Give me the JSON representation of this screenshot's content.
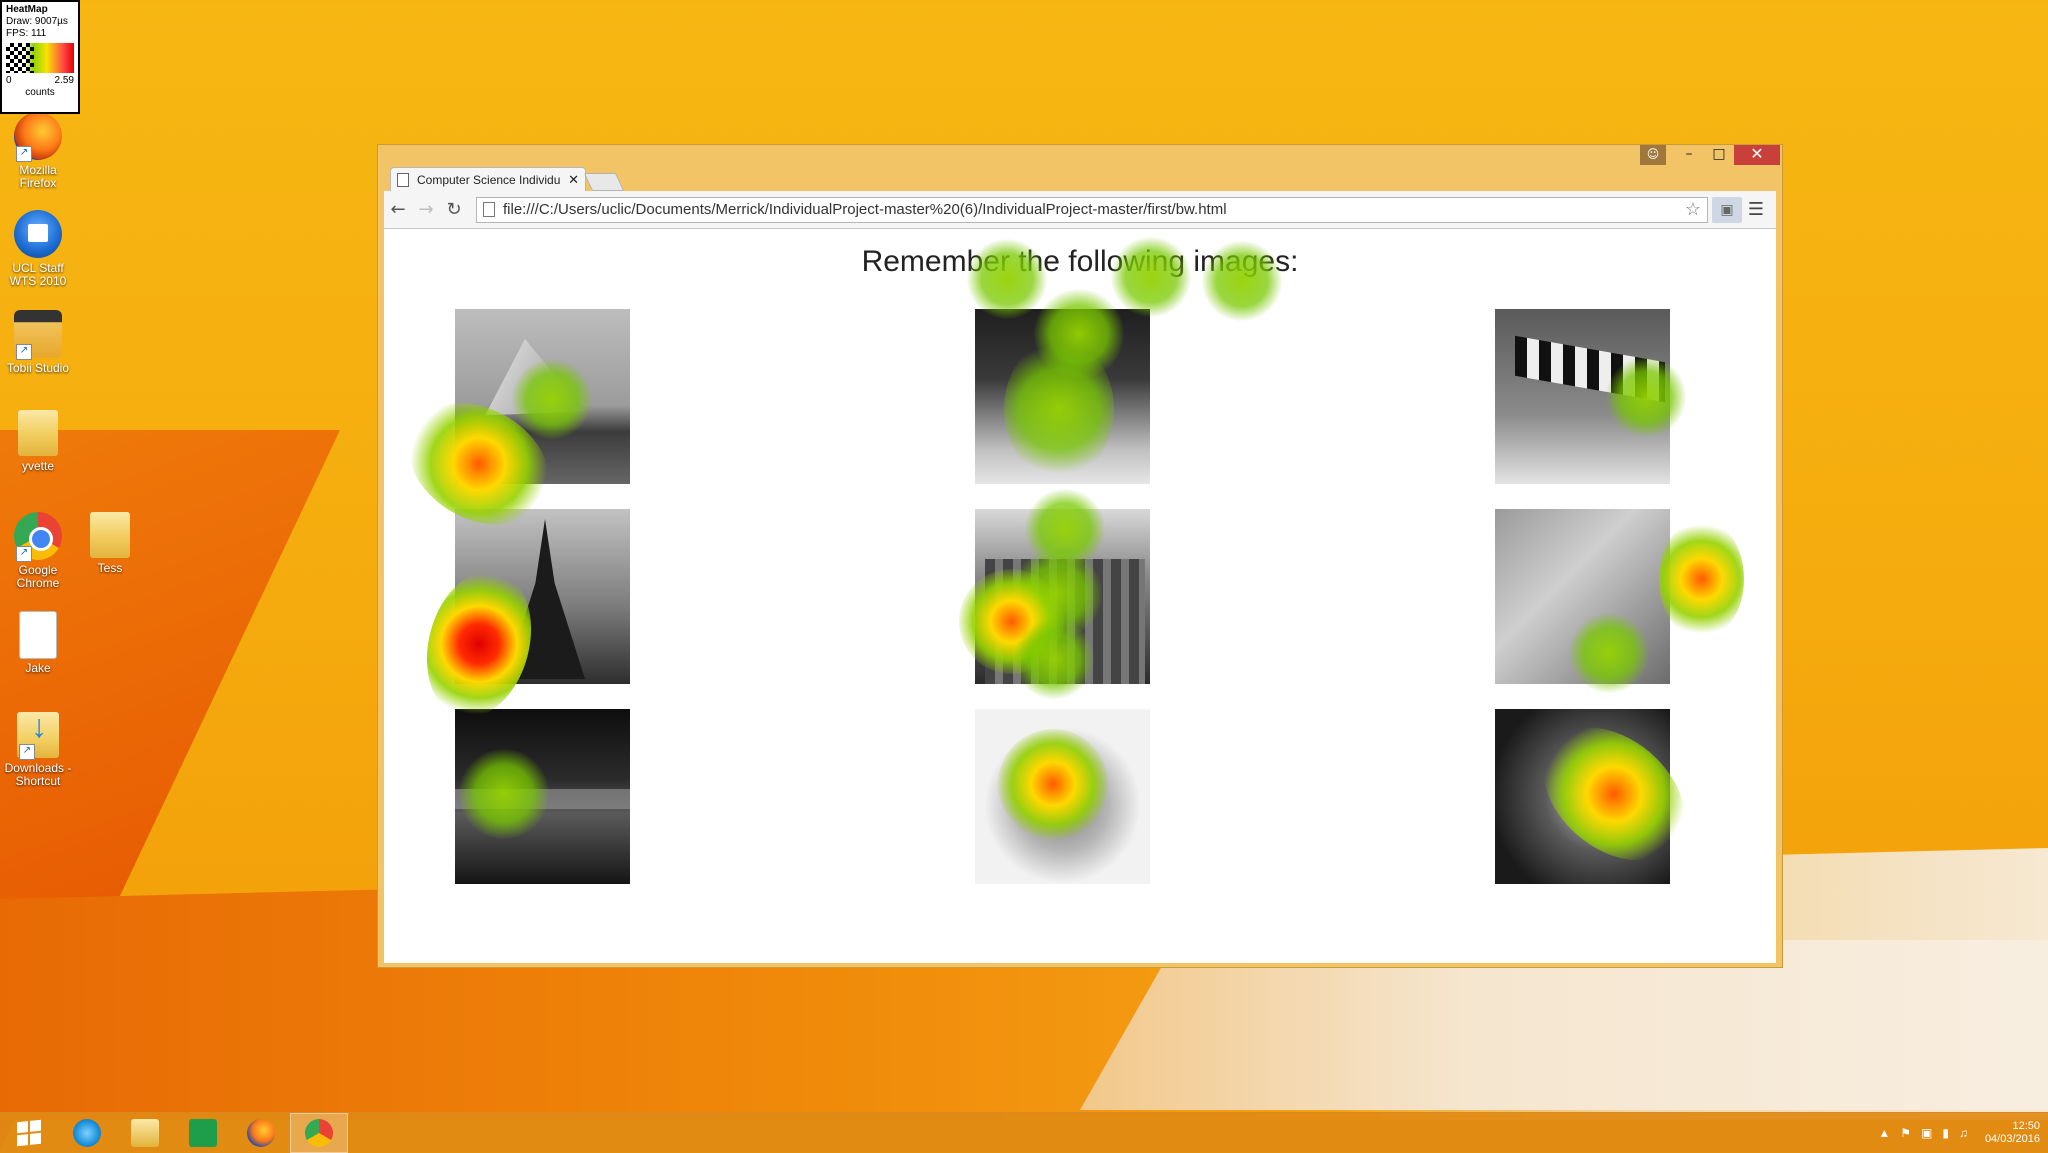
{
  "heatmap_widget": {
    "title": "HeatMap",
    "draw": "Draw: 9007µs",
    "fps": "FPS: 111",
    "scale_min": "0",
    "scale_max": "2.59",
    "unit": "counts"
  },
  "desktop": {
    "icons": [
      {
        "label": "Mozilla Firefox",
        "icon": "firefox-icon"
      },
      {
        "label": "UCL Staff WTS 2010",
        "icon": "ucl-wts-icon"
      },
      {
        "label": "Tobii Studio",
        "icon": "tobii-studio-icon"
      },
      {
        "label": "yvette",
        "icon": "folder-icon"
      },
      {
        "label": "Google Chrome",
        "icon": "chrome-icon"
      },
      {
        "label": "Tess",
        "icon": "folder-icon"
      },
      {
        "label": "Jake",
        "icon": "document-icon"
      },
      {
        "label": "Downloads - Shortcut",
        "icon": "downloads-folder-icon"
      }
    ]
  },
  "browser": {
    "tab_title": "Computer Science Individu",
    "url": "file:///C:/Users/uclic/Documents/Merrick/IndividualProject-master%20(6)/IndividualProject-master/first/bw.html",
    "window_controls": {
      "user": "☺",
      "minimize": "–",
      "maximize": "□",
      "close": "✕"
    }
  },
  "page": {
    "heading": "Remember the following images:",
    "images": [
      {
        "id": "boat",
        "desc": "sailing ship"
      },
      {
        "id": "runners",
        "desc": "marathon runners"
      },
      {
        "id": "windsock",
        "desc": "windsock"
      },
      {
        "id": "eiffel",
        "desc": "Eiffel tower"
      },
      {
        "id": "building",
        "desc": "old building"
      },
      {
        "id": "toaster",
        "desc": "toaster"
      },
      {
        "id": "bridge",
        "desc": "bridge at night"
      },
      {
        "id": "oranges",
        "desc": "oranges"
      },
      {
        "id": "dragon",
        "desc": "dragon statue"
      }
    ]
  },
  "taskbar": {
    "apps": [
      "start-button",
      "internet-explorer",
      "file-explorer",
      "store",
      "firefox",
      "chrome"
    ],
    "time": "12:50",
    "date": "04/03/2016"
  },
  "colors": {
    "desktop_bg": "#f5ad0e",
    "window_frame": "#f2c465",
    "close_button": "#c9403a",
    "heat_low": "#8bd400",
    "heat_mid": "#f6e400",
    "heat_high": "#e30000"
  }
}
